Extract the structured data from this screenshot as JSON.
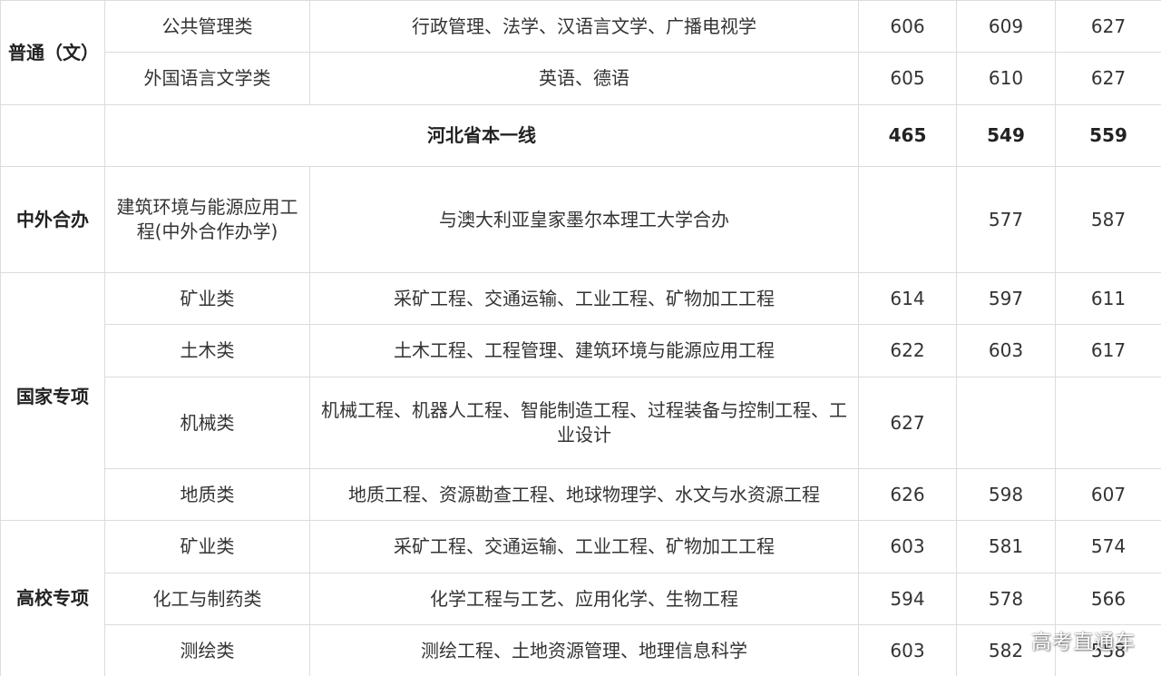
{
  "rows": [
    {
      "batch": "普通（文）",
      "category": "公共管理类",
      "majors": "行政管理、法学、汉语言文学、广播电视学",
      "s1": "606",
      "s2": "609",
      "s3": "627"
    },
    {
      "category": "外国语言文学类",
      "majors": "英语、德语",
      "s1": "605",
      "s2": "610",
      "s3": "627"
    },
    {
      "summary": "河北省本一线",
      "s1": "465",
      "s2": "549",
      "s3": "559"
    },
    {
      "batch": "中外合办",
      "category": "建筑环境与能源应用工程(中外合作办学)",
      "majors": "与澳大利亚皇家墨尔本理工大学合办",
      "s1": "",
      "s2": "577",
      "s3": "587"
    },
    {
      "batch": "国家专项",
      "category": "矿业类",
      "majors": "采矿工程、交通运输、工业工程、矿物加工工程",
      "s1": "614",
      "s2": "597",
      "s3": "611"
    },
    {
      "category": "土木类",
      "majors": "土木工程、工程管理、建筑环境与能源应用工程",
      "s1": "622",
      "s2": "603",
      "s3": "617"
    },
    {
      "category": "机械类",
      "majors": "机械工程、机器人工程、智能制造工程、过程装备与控制工程、工业设计",
      "s1": "627",
      "s2": "",
      "s3": ""
    },
    {
      "category": "地质类",
      "majors": "地质工程、资源勘查工程、地球物理学、水文与水资源工程",
      "s1": "626",
      "s2": "598",
      "s3": "607"
    },
    {
      "batch": "高校专项",
      "category": "矿业类",
      "majors": "采矿工程、交通运输、工业工程、矿物加工工程",
      "s1": "603",
      "s2": "581",
      "s3": "574"
    },
    {
      "category": "化工与制药类",
      "majors": "化学工程与工艺、应用化学、生物工程",
      "s1": "594",
      "s2": "578",
      "s3": "566"
    },
    {
      "category": "测绘类",
      "majors": "测绘工程、土地资源管理、地理信息科学",
      "s1": "603",
      "s2": "582",
      "s3": "558"
    }
  ],
  "watermark": "高考直通车"
}
